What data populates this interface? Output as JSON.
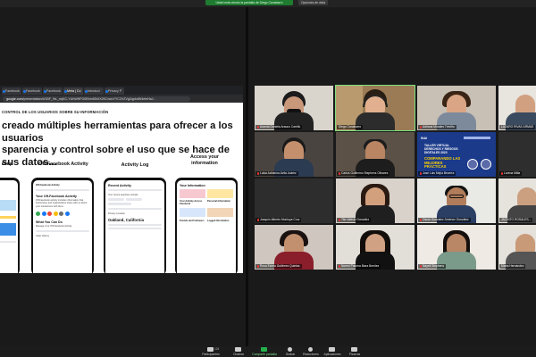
{
  "meeting": {
    "sharing_banner": "Usted está viendo la pantalla de Diego Canabarro",
    "view_options": "Opciones de vista"
  },
  "browser": {
    "tabs": [
      "Facebook",
      "Facebook",
      "Facebook",
      "Meta | Co",
      "Introduci",
      "Privacy P"
    ],
    "url_prefix": "google.com",
    "url_rest": "/presentation/d/1BF_9rL_eqKC-YUhWHFG0Bhm55rXX2KCrwoYYC2VZVgZqpkdW4eleHaJ..."
  },
  "slide": {
    "section": "CONTROL DE LOS USUARIOS SOBRE SU INFORMACIÓN",
    "headline_1": "creado múltiples herramientas para ofrecer a los usuarios",
    "headline_2": "sparencia y control sobre el uso que se hace de sus datos...",
    "col_1": "ckup",
    "col_2": "Off-Facebook Activity",
    "col_3": "Activity Log",
    "col_4a": "Access your",
    "col_4b": "information",
    "phone_2_title": "Your Off-Facebook Activity",
    "phone_2_sub": "Off-Facebook activity includes information that businesses and organizations share with us about your interactions with them.",
    "phone_2_item1": "What You Can Do",
    "phone_2_item2": "Manage Your Off-Facebook Activity",
    "phone_2_item3": "Clear History",
    "phone_3_title": "Recent Activity",
    "phone_3_sub": "Your recent searches include",
    "phone_3_item1": "Privacy Location",
    "phone_3_item2": "Oakland, California",
    "phone_4_title": "Your Information",
    "phone_4_item1": "Your Activity Across Facebook",
    "phone_4_item2": "Personal Information",
    "phone_4_item3": "Friends and Followers",
    "phone_4_item4": "Logged Information"
  },
  "participants": [
    {
      "name": "Aranda Daniela Arauco Carrillo"
    },
    {
      "name": "Diego Canabarro"
    },
    {
      "name": "Adriana Morales Treviño"
    },
    {
      "name": "LÁZARO RIVAS ARMAS"
    },
    {
      "name": "Luisa Adrianna Ávila Juárez"
    },
    {
      "name": "Carlos Guillermo Stephens Olivares"
    },
    {
      "name": "José Luis Mejía Becerra"
    },
    {
      "name": "Lorena Mitla"
    },
    {
      "name": "Joaquín Alberto Montoya Cruz"
    },
    {
      "name": "Tito Valerio González"
    },
    {
      "name": "Oscar Gonzalez Jiménez González"
    },
    {
      "name": "JACINTO ROSALES..."
    },
    {
      "name": "Rosa Estela Gutiérrez Quintas"
    },
    {
      "name": "Noemí Paloma Báez Benítez"
    },
    {
      "name": "Nayeli Stephens"
    },
    {
      "name": "Marta Hernández"
    }
  ],
  "poster": {
    "logo": "INAI",
    "line1": "TALLER VIRTUAL DERECHOS Y RIESGOS DIGITALES 2023",
    "line2": "COMPARANDO LAS MEJORES PRÁCTICAS",
    "line3": "Modalidad virtual"
  },
  "toolbar": {
    "participants_count": "124",
    "items": [
      "Participantes",
      "Chatear",
      "Compartir pantalla",
      "Grabar",
      "Reacciones",
      "Aplicaciones",
      "Pizarras"
    ]
  }
}
